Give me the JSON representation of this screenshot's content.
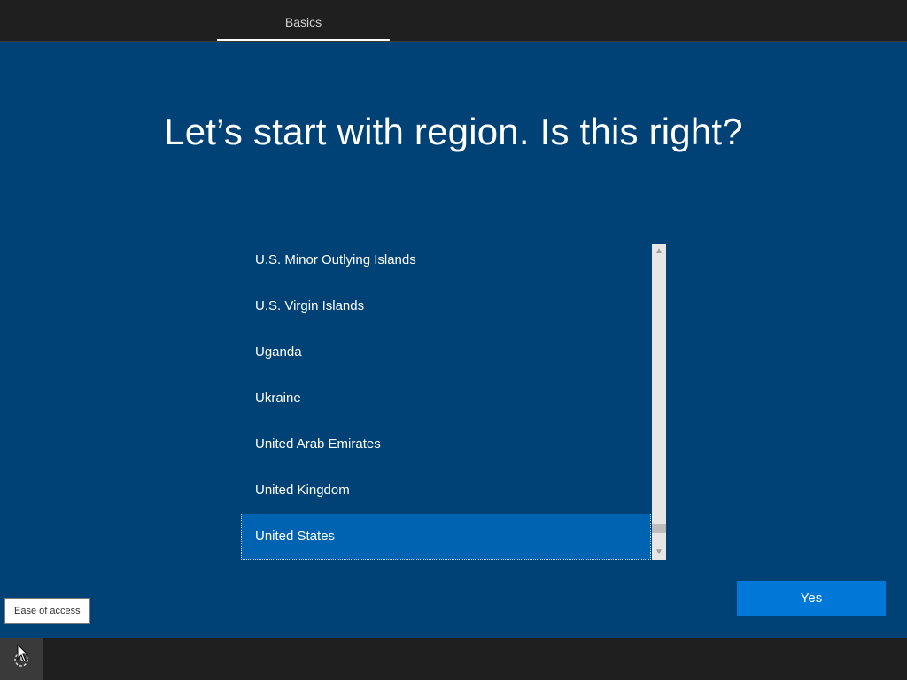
{
  "header": {
    "tabs": [
      {
        "label": "Basics",
        "active": true
      }
    ]
  },
  "main": {
    "title": "Let’s start with region. Is this right?",
    "regions": [
      {
        "label": "U.S. Minor Outlying Islands",
        "selected": false
      },
      {
        "label": "U.S. Virgin Islands",
        "selected": false
      },
      {
        "label": "Uganda",
        "selected": false
      },
      {
        "label": "Ukraine",
        "selected": false
      },
      {
        "label": "United Arab Emirates",
        "selected": false
      },
      {
        "label": "United Kingdom",
        "selected": false
      },
      {
        "label": "United States",
        "selected": true
      }
    ],
    "yes_button": "Yes"
  },
  "footer": {
    "ease_of_access_tooltip": "Ease of access",
    "ease_of_access_icon": "ease-of-access-icon"
  },
  "colors": {
    "background": "#004275",
    "selected_item": "#0063b1",
    "button": "#0078d7",
    "bars": "#1f1f1f"
  }
}
